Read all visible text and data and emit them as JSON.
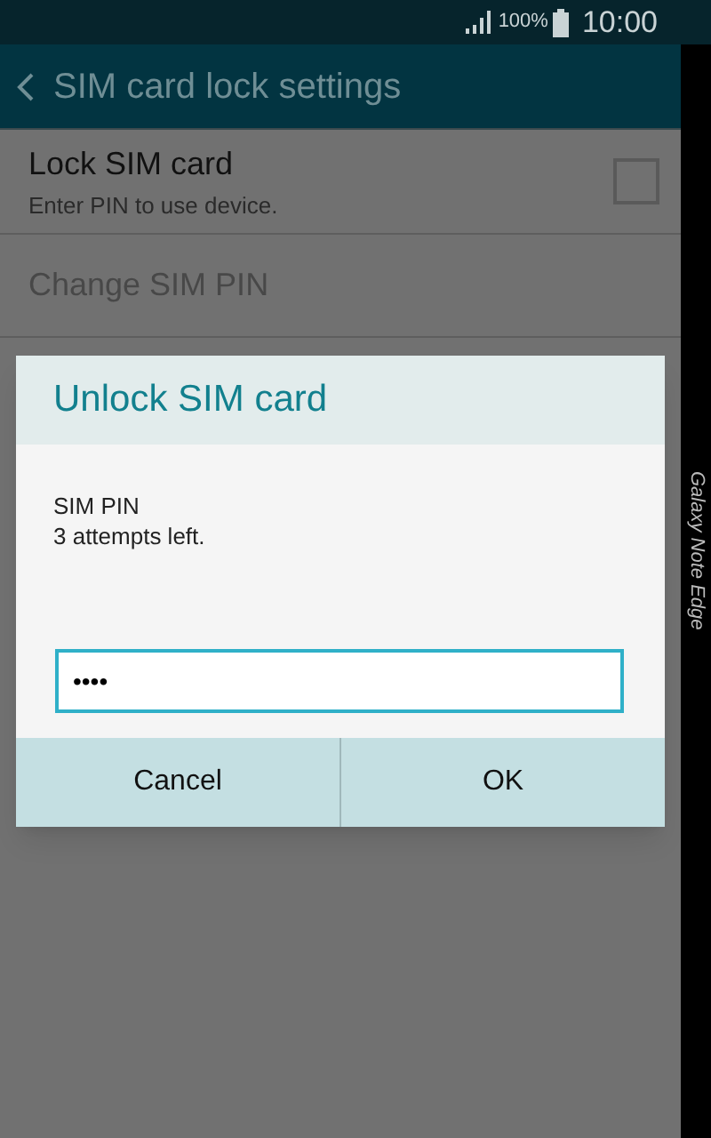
{
  "status_bar": {
    "battery": "100%",
    "time": "10:00"
  },
  "app_bar": {
    "title": "SIM card lock settings"
  },
  "settings": [
    {
      "kind": "checkbox",
      "title": "Lock SIM card",
      "subtitle": "Enter PIN to use device.",
      "checked": false,
      "disabled": false
    },
    {
      "kind": "plain",
      "title": "Change SIM PIN",
      "disabled": true
    }
  ],
  "dialog": {
    "title": "Unlock SIM card",
    "message": [
      "SIM PIN",
      "3 attempts left."
    ],
    "pin_field": {
      "value": "••••"
    },
    "buttons": [
      "Cancel",
      "OK"
    ]
  },
  "edge_screen": {
    "label": "Galaxy Note Edge"
  }
}
